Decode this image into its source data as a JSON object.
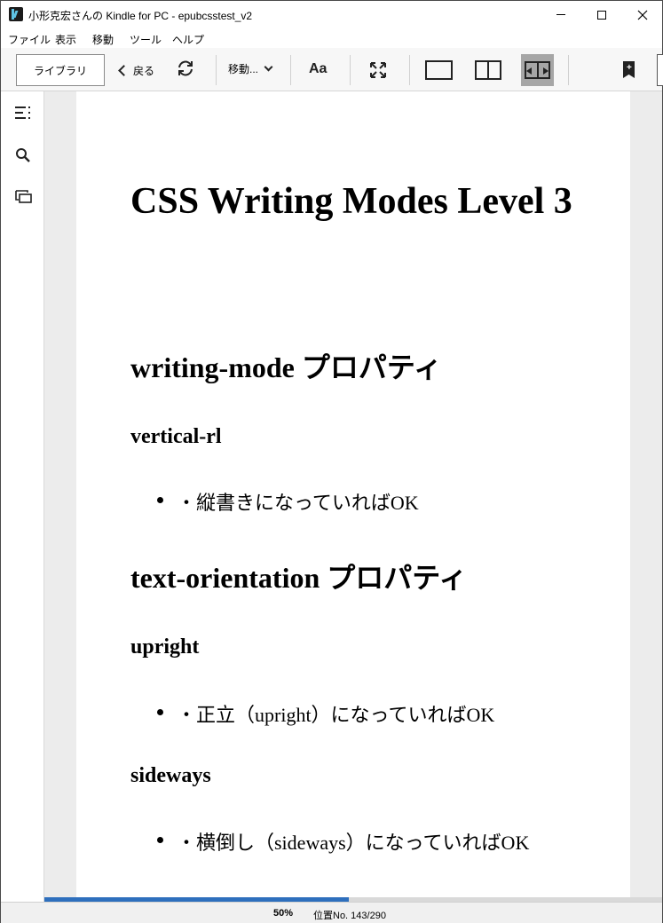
{
  "window": {
    "title": "小形克宏さんの Kindle for PC - epubcsstest_v2",
    "icon": "kindle-app-icon"
  },
  "menu": {
    "items": [
      "ファイル",
      "表示",
      "移動",
      "ツール",
      "ヘルプ"
    ]
  },
  "toolbar": {
    "library_label": "ライブラリ",
    "back_label": "戻る",
    "goto_label": "移動...",
    "font_label": "Aa",
    "icons": [
      "sync-icon",
      "fullscreen-icon",
      "single-page-icon",
      "two-page-icon",
      "continuous-scroll-icon",
      "add-bookmark-icon"
    ]
  },
  "sidebar": {
    "icons": [
      "table-of-contents-icon",
      "search-icon",
      "flashcards-icon"
    ]
  },
  "book": {
    "h1_title": "CSS Writing Modes Level 3",
    "section1_heading": "writing-mode プロパティ",
    "section1_sub": "vertical-rl",
    "section1_item": "・縦書きになっていればOK",
    "section2_heading": "text-orientation プロパティ",
    "section2_sub1": "upright",
    "section2_item1": "・正立（upright）になっていればOK",
    "section2_sub2": "sideways",
    "section2_item2": "・横倒し（sideways）になっていればOK"
  },
  "status": {
    "percent": "50%",
    "location": "位置No. 143/290",
    "progress_fraction": 0.493
  },
  "colors": {
    "progress": "#2e6fbd",
    "selected_view": "#a6a6a6"
  }
}
